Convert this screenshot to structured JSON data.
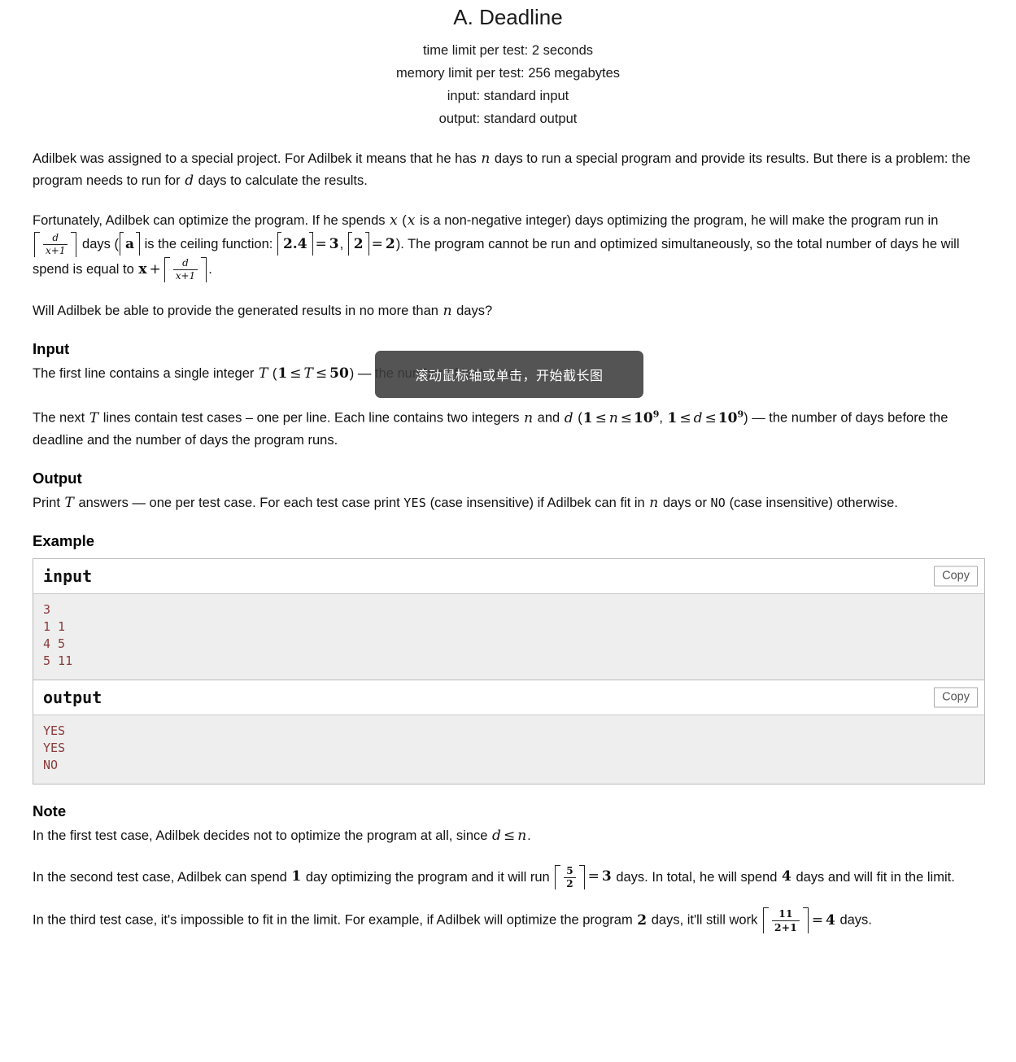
{
  "problem": {
    "title": "A. Deadline",
    "limits": [
      "time limit per test: 2 seconds",
      "memory limit per test: 256 megabytes",
      "input: standard input",
      "output: standard output"
    ]
  },
  "statement": {
    "p1_a": "Adilbek was assigned to a special project. For Adilbek it means that he has ",
    "p1_n": "n",
    "p1_b": " days to run a special program and provide its results. But there is a problem: the program needs to run for ",
    "p1_d": "d",
    "p1_c": " days to calculate the results.",
    "p2_a": "Fortunately, Adilbek can optimize the program. If he spends ",
    "p2_x1": "x",
    "p2_b": " (",
    "p2_x2": "x",
    "p2_c": " is a non-negative integer) days optimizing the program, he will make the program run in ",
    "frac1_num": "d",
    "frac1_den": "x+1",
    "p2_d": " days (",
    "p2_a_var": "a",
    "p2_e": " is the ceiling function: ",
    "ceil24": "2.4",
    "eq1": "=",
    "val3": "3",
    "comma": ", ",
    "ceil2": "2",
    "eq2": "=",
    "val2": "2",
    "p2_f": "). The program cannot be run and optimized simultaneously, so the total number of days he will spend is equal to ",
    "p2_x3": "x",
    "plus": "+",
    "frac2_num": "d",
    "frac2_den": "x+1",
    "p2_g": ".",
    "p3_a": "Will Adilbek be able to provide the generated results in no more than ",
    "p3_n": "n",
    "p3_b": " days?"
  },
  "input_section": {
    "heading": "Input",
    "l1_a": "The first line contains a single integer ",
    "l1_T": "T",
    "l1_b": " (",
    "l1_one": "1",
    "l1_le1": "≤",
    "l1_T2": "T",
    "l1_le2": "≤",
    "l1_fifty": "50",
    "l1_c": ") — the number of test cases.",
    "l2_a": "The next ",
    "l2_T": "T",
    "l2_b": " lines contain test cases – one per line. Each line contains two integers ",
    "l2_n": "n",
    "l2_and": " and ",
    "l2_d": "d",
    "l2_c": " (",
    "l2_one_a": "1",
    "l2_le_a": "≤",
    "l2_n2": "n",
    "l2_le_b": "≤",
    "l2_pow_a": "10",
    "l2_exp_a": "9",
    "l2_sep": ", ",
    "l2_one_b": "1",
    "l2_le_c": "≤",
    "l2_d2": "d",
    "l2_le_d": "≤",
    "l2_pow_b": "10",
    "l2_exp_b": "9",
    "l2_d_txt": ") — the number of days before the deadline and the number of days the program runs."
  },
  "output_section": {
    "heading": "Output",
    "o1_a": "Print ",
    "o1_T": "T",
    "o1_b": " answers — one per test case. For each test case print ",
    "o1_yes": "YES",
    "o1_c": " (case insensitive) if Adilbek can fit in ",
    "o1_n": "n",
    "o1_d": " days or ",
    "o1_no": "NO",
    "o1_e": " (case insensitive) otherwise."
  },
  "example_section": {
    "heading": "Example",
    "input_label": "input",
    "output_label": "output",
    "copy_label": "Copy",
    "input_data": "3\n1 1\n4 5\n5 11",
    "output_data": "YES\nYES\nNO"
  },
  "note_section": {
    "heading": "Note",
    "n1_a": "In the first test case, Adilbek decides not to optimize the program at all, since ",
    "n1_d": "d",
    "n1_le": "≤",
    "n1_n": "n",
    "n1_b": ".",
    "n2_a": "In the second test case, Adilbek can spend ",
    "n2_one": "1",
    "n2_b": " day optimizing the program and it will run ",
    "n2_frac_num": "5",
    "n2_frac_den": "2",
    "n2_eq": "=",
    "n2_three": "3",
    "n2_c": " days. In total, he will spend ",
    "n2_four": "4",
    "n2_d": " days and will fit in the limit.",
    "n3_a": "In the third test case, it's impossible to fit in the limit. For example, if Adilbek will optimize the program ",
    "n3_two": "2",
    "n3_b": " days, it'll still work ",
    "n3_frac_num": "11",
    "n3_frac_den": "2+1",
    "n3_eq": "=",
    "n3_four": "4",
    "n3_c": " days."
  },
  "overlay": {
    "capture_tooltip": "滚动鼠标轴或单击，开始截长图"
  },
  "colors": {
    "sample_data_text": "#8b3a3a",
    "sample_data_bg": "#eeeeee",
    "tooltip_bg": "rgba(60,60,60,0.88)"
  }
}
